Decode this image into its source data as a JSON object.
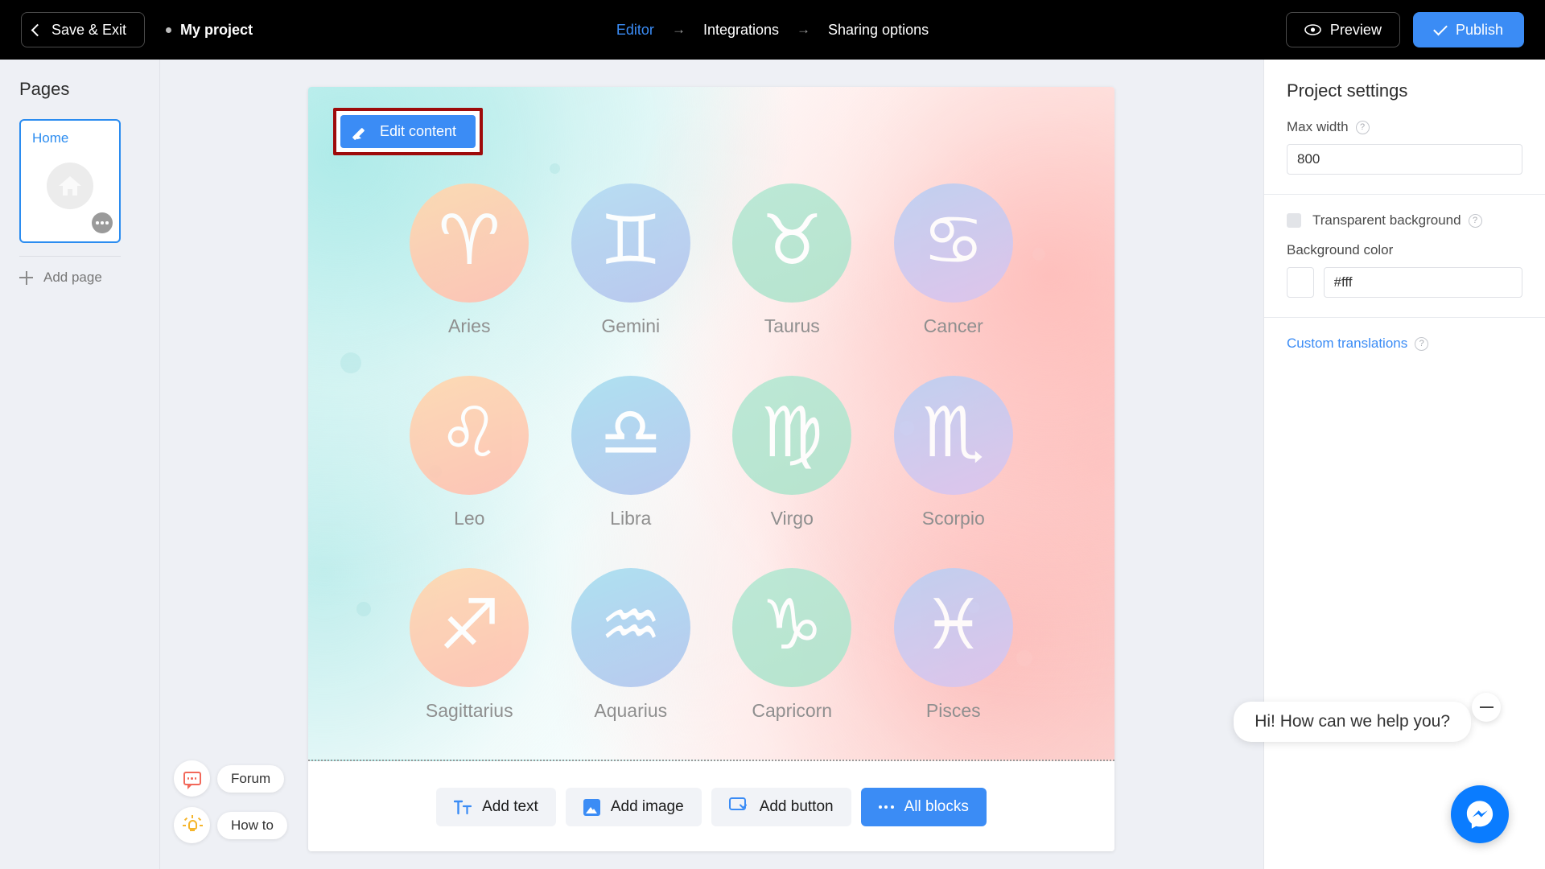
{
  "topbar": {
    "save_exit": "Save & Exit",
    "project_name": "My project",
    "breadcrumbs": [
      {
        "label": "Editor",
        "active": true
      },
      {
        "label": "Integrations",
        "active": false
      },
      {
        "label": "Sharing options",
        "active": false
      }
    ],
    "arrow": "→",
    "preview": "Preview",
    "publish": "Publish",
    "accent_color": "#3b8cf5",
    "bar_color": "#000000"
  },
  "sidebar": {
    "title": "Pages",
    "pages": [
      {
        "label": "Home",
        "selected": true,
        "icon": "home-icon"
      }
    ],
    "add_page": "Add page"
  },
  "canvas": {
    "edit_content": "Edit content",
    "highlight_color": "#9e0b0b",
    "zodiac": [
      {
        "label": "Aries",
        "glyph": "♈",
        "c1": "#ffd9b0",
        "c2": "#ffc0b2"
      },
      {
        "label": "Gemini",
        "glyph": "♊",
        "c1": "#b5dcf2",
        "c2": "#b6c4ee"
      },
      {
        "label": "Taurus",
        "glyph": "♉",
        "c1": "#b7e8d4",
        "c2": "#b2e4cd"
      },
      {
        "label": "Cancer",
        "glyph": "♋",
        "c1": "#bcd0f2",
        "c2": "#dcc4ee"
      },
      {
        "label": "Leo",
        "glyph": "♌",
        "c1": "#ffd9b0",
        "c2": "#ffc0b2"
      },
      {
        "label": "Libra",
        "glyph": "♎",
        "c1": "#a9dff0",
        "c2": "#b4c6ef"
      },
      {
        "label": "Virgo",
        "glyph": "♍",
        "c1": "#b7e8d4",
        "c2": "#b2e4cd"
      },
      {
        "label": "Scorpio",
        "glyph": "♏",
        "c1": "#bcd0f2",
        "c2": "#dcc4ee"
      },
      {
        "label": "Sagittarius",
        "glyph": "♐",
        "c1": "#ffd9b0",
        "c2": "#ffc0b2"
      },
      {
        "label": "Aquarius",
        "glyph": "♒",
        "c1": "#a9dff0",
        "c2": "#b4c6ef"
      },
      {
        "label": "Capricorn",
        "glyph": "♑",
        "c1": "#b7e8d4",
        "c2": "#b2e4cd"
      },
      {
        "label": "Pisces",
        "glyph": "♓",
        "c1": "#bcd0f2",
        "c2": "#dcc4ee"
      }
    ],
    "toolbar": [
      {
        "label": "Add text",
        "icon": "text-icon",
        "primary": false
      },
      {
        "label": "Add image",
        "icon": "image-icon",
        "primary": false
      },
      {
        "label": "Add button",
        "icon": "button-icon",
        "primary": false
      },
      {
        "label": "All blocks",
        "icon": "dots-icon",
        "primary": true
      }
    ]
  },
  "help": {
    "forum": "Forum",
    "how_to": "How to"
  },
  "settings": {
    "title": "Project settings",
    "max_width_label": "Max width",
    "max_width_value": "800",
    "transparent_background_label": "Transparent background",
    "transparent_background_checked": false,
    "background_color_label": "Background color",
    "background_color_value": "#fff",
    "custom_translations": "Custom translations",
    "help_glyph": "?"
  },
  "chat": {
    "prompt": "Hi! How can we help you?",
    "widget": "messenger-icon",
    "brand_color": "#0a7cff"
  }
}
